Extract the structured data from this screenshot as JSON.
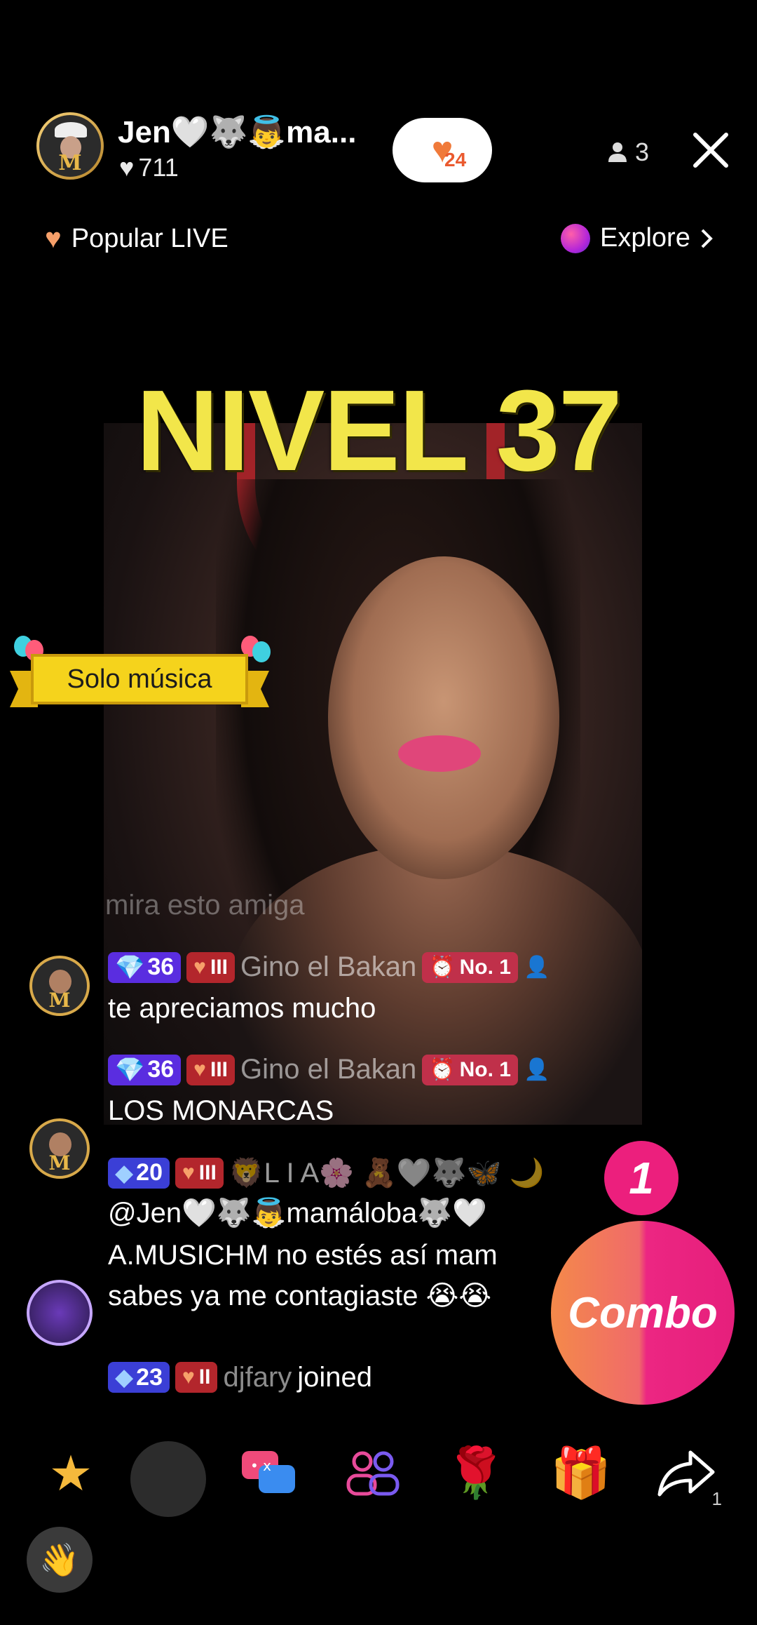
{
  "header": {
    "host_name": "Jen🤍🐺👼ma...",
    "likes": "711",
    "follow_count": "24",
    "viewers": "3"
  },
  "nav": {
    "popular_label": "Popular LIVE",
    "explore_label": "Explore"
  },
  "overlay": {
    "title": "NIVEL 37",
    "banner_text": "Solo música"
  },
  "chat": {
    "faded_text": "mira esto amiga",
    "messages": [
      {
        "level": "36",
        "fan_level": "III",
        "username": "Gino el Bakan",
        "rank": "No. 1",
        "text": "te apreciamos mucho"
      },
      {
        "level": "36",
        "fan_level": "III",
        "username": "Gino el Bakan",
        "rank": "No. 1",
        "text": "LOS MONARCAS"
      },
      {
        "level": "20",
        "fan_level": "III",
        "username": "🦁L I A🌸 🧸🤍🐺🦋 🌙",
        "line1": "@Jen🤍🐺👼mamáloba🐺🤍",
        "line2": "A.MUSICHM no estés así mam",
        "line3": "sabes ya me contagiaste 😭😭"
      }
    ],
    "join": {
      "level": "23",
      "fan_level": "II",
      "username": "djfary",
      "action": "joined"
    }
  },
  "combo": {
    "count": "1",
    "label": "Combo"
  },
  "bottom_bar": {
    "share_count": "1"
  },
  "colors": {
    "overlay_title": "#f2e64a",
    "level_badge_purple": "#5a2de0",
    "level_badge_blue": "#3b3fd6",
    "fan_badge": "#b3262c",
    "combo_pink": "#ec1f7d",
    "combo_orange": "#f4894a"
  },
  "icons": [
    "heart-icon",
    "person-icon",
    "close-icon",
    "chevron-right-icon",
    "gem-icon",
    "rose-icon",
    "gift-icon",
    "share-icon",
    "star-icon",
    "chat-icon",
    "people-icon",
    "wave-icon"
  ]
}
